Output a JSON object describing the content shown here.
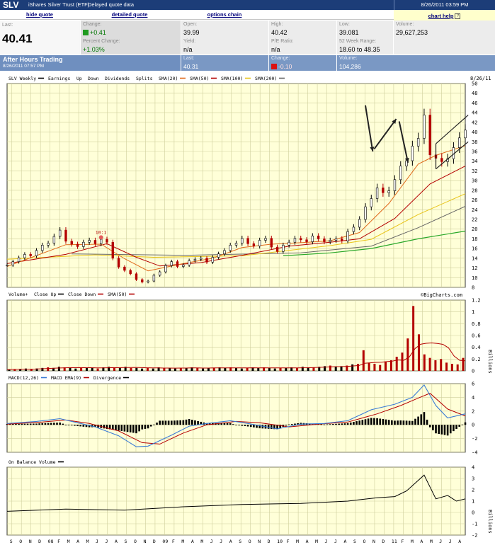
{
  "quote": {
    "symbol": "SLV",
    "name": "iShares Silver Trust (ETF)",
    "delay_note": "Delayed quote data",
    "timestamp": "8/26/2011 03:59 PM",
    "links": {
      "hide": "hide quote",
      "detailed": "detailed quote",
      "options": "options chain",
      "help": "chart help"
    },
    "last_label": "Last:",
    "last": "40.41",
    "change_label": "Change:",
    "change": "+0.41",
    "pct_label": "Percent Change:",
    "pct": "+1.03%",
    "open_label": "Open:",
    "open": "39.99",
    "yield_label": "Yield:",
    "yield": "n/a",
    "high_label": "High:",
    "high": "40.42",
    "pe_label": "P/E Ratio:",
    "pe": "n/a",
    "low_label": "Low:",
    "low": "39.081",
    "range_label": "52 Week Range:",
    "range": "18.60 to 48.35",
    "volume_label": "Volume:",
    "volume": "29,627,253"
  },
  "after_hours": {
    "title": "After Hours Trading",
    "time": "8/26/2011 07:57 PM",
    "last_label": "Last:",
    "last": "40.31",
    "change_label": "Change:",
    "change": "-0.10",
    "volume_label": "Volume:",
    "volume": "104,286"
  },
  "colors": {
    "header": "#1c3d78",
    "quote_bg": "#f0f0f0",
    "after_bg": "#7a98c4",
    "chart_bg": "#ffffd8",
    "grid": "#cfcf9d",
    "up": "#000000",
    "down": "#b40000",
    "sma20": "#e06a1a",
    "sma50": "#b40000",
    "sma100": "#e8c418",
    "sma200": "#666666",
    "green": "#2aa82a",
    "macd": "#3a7bd5",
    "signal": "#b40000"
  },
  "chart_data": {
    "type": "line",
    "panels": {
      "price": {
        "legend": [
          "SLV Weekly",
          "Earnings",
          "Up",
          "Down",
          "Dividends",
          "Splits",
          "SMA(20)",
          "SMA(50)",
          "SMA(100)",
          "SMA(200)"
        ],
        "date_label": "8/26/11",
        "yticks": [
          8,
          10,
          12,
          14,
          16,
          18,
          20,
          22,
          24,
          26,
          28,
          30,
          32,
          34,
          36,
          38,
          40,
          42,
          44,
          46,
          48,
          50
        ],
        "ylim": [
          8,
          50
        ],
        "split_label": "10:1",
        "watermark": "©BigCharts.com",
        "close": [
          [
            0,
            12.6
          ],
          [
            2,
            13.3
          ],
          [
            4,
            14.1
          ],
          [
            6,
            14.8
          ],
          [
            8,
            14.5
          ],
          [
            10,
            15.6
          ],
          [
            12,
            16.7
          ],
          [
            14,
            17.1
          ],
          [
            16,
            18.5
          ],
          [
            18,
            19.8
          ],
          [
            20,
            17.5
          ],
          [
            22,
            16.9
          ],
          [
            24,
            16.4
          ],
          [
            26,
            17.3
          ],
          [
            28,
            17.7
          ],
          [
            30,
            17.0
          ],
          [
            32,
            17.9
          ],
          [
            34,
            17.3
          ],
          [
            36,
            14.0
          ],
          [
            38,
            12.2
          ],
          [
            40,
            11.5
          ],
          [
            42,
            10.8
          ],
          [
            44,
            9.6
          ],
          [
            46,
            9.1
          ],
          [
            48,
            9.3
          ],
          [
            50,
            10.5
          ],
          [
            52,
            11.2
          ],
          [
            54,
            12.5
          ],
          [
            56,
            13.3
          ],
          [
            58,
            12.3
          ],
          [
            60,
            12.6
          ],
          [
            62,
            13.5
          ],
          [
            64,
            13.8
          ],
          [
            66,
            14.0
          ],
          [
            68,
            13.2
          ],
          [
            70,
            14.2
          ],
          [
            72,
            14.9
          ],
          [
            74,
            15.6
          ],
          [
            76,
            16.7
          ],
          [
            78,
            17.1
          ],
          [
            80,
            18.1
          ],
          [
            82,
            17.0
          ],
          [
            84,
            16.5
          ],
          [
            86,
            17.7
          ],
          [
            88,
            18.1
          ],
          [
            90,
            16.3
          ],
          [
            92,
            15.4
          ],
          [
            94,
            16.7
          ],
          [
            96,
            17.3
          ],
          [
            98,
            18.1
          ],
          [
            100,
            17.8
          ],
          [
            102,
            17.4
          ],
          [
            104,
            18.6
          ],
          [
            106,
            18.0
          ],
          [
            108,
            17.4
          ],
          [
            110,
            17.7
          ],
          [
            112,
            18.0
          ],
          [
            114,
            17.6
          ],
          [
            116,
            19.5
          ],
          [
            118,
            20.4
          ],
          [
            120,
            22.0
          ],
          [
            122,
            24.6
          ],
          [
            124,
            26.3
          ],
          [
            126,
            28.5
          ],
          [
            128,
            27.5
          ],
          [
            130,
            27.9
          ],
          [
            132,
            30.2
          ],
          [
            134,
            33.0
          ],
          [
            136,
            34.1
          ],
          [
            138,
            37.1
          ],
          [
            140,
            38.7
          ],
          [
            142,
            43.5
          ],
          [
            144,
            35.3
          ],
          [
            146,
            34.6
          ],
          [
            148,
            33.9
          ],
          [
            150,
            34.5
          ],
          [
            152,
            36.8
          ],
          [
            154,
            38.8
          ],
          [
            156,
            40.4
          ]
        ],
        "sma20": [
          [
            0,
            12.3
          ],
          [
            20,
            16.8
          ],
          [
            32,
            16.9
          ],
          [
            40,
            13.9
          ],
          [
            48,
            11.4
          ],
          [
            60,
            12.9
          ],
          [
            70,
            14.0
          ],
          [
            80,
            16.2
          ],
          [
            90,
            16.9
          ],
          [
            100,
            17.2
          ],
          [
            110,
            17.6
          ],
          [
            120,
            19.3
          ],
          [
            130,
            25.3
          ],
          [
            140,
            33.4
          ],
          [
            146,
            35.2
          ],
          [
            156,
            37.2
          ]
        ],
        "sma50": [
          [
            0,
            12.9
          ],
          [
            20,
            14.8
          ],
          [
            34,
            17.0
          ],
          [
            44,
            14.2
          ],
          [
            52,
            12.4
          ],
          [
            66,
            13.1
          ],
          [
            80,
            14.6
          ],
          [
            96,
            16.5
          ],
          [
            110,
            17.3
          ],
          [
            120,
            18.0
          ],
          [
            132,
            22.2
          ],
          [
            144,
            29.3
          ],
          [
            156,
            33.0
          ]
        ],
        "sma100": [
          [
            0,
            13.8
          ],
          [
            30,
            14.7
          ],
          [
            50,
            14.2
          ],
          [
            80,
            14.5
          ],
          [
            110,
            16.6
          ],
          [
            124,
            17.9
          ],
          [
            140,
            23.0
          ],
          [
            156,
            27.3
          ]
        ],
        "sma200": [
          [
            22,
            14.9
          ],
          [
            60,
            14.6
          ],
          [
            100,
            15.1
          ],
          [
            124,
            16.5
          ],
          [
            140,
            20.3
          ],
          [
            156,
            24.7
          ]
        ],
        "green": [
          [
            94,
            14.5
          ],
          [
            110,
            15.1
          ],
          [
            124,
            16.0
          ],
          [
            140,
            18.0
          ],
          [
            156,
            19.6
          ]
        ]
      },
      "volume": {
        "legend": [
          "Volume+",
          "Close Up",
          "Close Down",
          "SMA(50)"
        ],
        "unit": "Billions",
        "yticks": [
          0,
          0.2,
          0.4,
          0.6,
          0.8,
          1,
          1.2
        ],
        "ylim": [
          0,
          1.2
        ],
        "values": [
          0.02,
          0.03,
          0.03,
          0.04,
          0.03,
          0.04,
          0.05,
          0.06,
          0.05,
          0.07,
          0.06,
          0.05,
          0.04,
          0.06,
          0.05,
          0.05,
          0.04,
          0.06,
          0.07,
          0.06,
          0.05,
          0.07,
          0.05,
          0.05,
          0.04,
          0.05,
          0.04,
          0.06,
          0.05,
          0.05,
          0.04,
          0.05,
          0.05,
          0.06,
          0.05,
          0.04,
          0.05,
          0.05,
          0.06,
          0.05,
          0.06,
          0.05,
          0.04,
          0.05,
          0.06,
          0.05,
          0.06,
          0.05,
          0.04,
          0.05,
          0.05,
          0.06,
          0.05,
          0.07,
          0.06,
          0.06,
          0.07,
          0.08,
          0.09,
          0.07,
          0.08,
          0.09,
          0.11,
          0.12,
          0.35,
          0.14,
          0.12,
          0.1,
          0.16,
          0.18,
          0.24,
          0.31,
          0.55,
          1.1,
          0.62,
          0.28,
          0.22,
          0.18,
          0.2,
          0.14,
          0.12,
          0.11,
          0.22
        ]
      },
      "macd": {
        "legend": [
          "MACD(12,26)",
          "MACD EMA(9)",
          "Divergence"
        ],
        "yticks": [
          -4,
          -2,
          0,
          2,
          4,
          6
        ],
        "ylim": [
          -4,
          6
        ],
        "macd": [
          [
            0,
            0.2
          ],
          [
            10,
            0.5
          ],
          [
            18,
            0.9
          ],
          [
            24,
            0.3
          ],
          [
            30,
            -0.3
          ],
          [
            38,
            -1.6
          ],
          [
            44,
            -3.2
          ],
          [
            48,
            -3.1
          ],
          [
            56,
            -1.5
          ],
          [
            62,
            -0.2
          ],
          [
            68,
            0.2
          ],
          [
            76,
            0.6
          ],
          [
            82,
            0.2
          ],
          [
            92,
            -0.6
          ],
          [
            100,
            0.1
          ],
          [
            108,
            0.2
          ],
          [
            116,
            0.6
          ],
          [
            124,
            2.2
          ],
          [
            132,
            3.0
          ],
          [
            138,
            4.0
          ],
          [
            142,
            5.8
          ],
          [
            146,
            2.8
          ],
          [
            150,
            1.0
          ],
          [
            156,
            1.6
          ]
        ],
        "signal": [
          [
            0,
            0.1
          ],
          [
            12,
            0.4
          ],
          [
            20,
            0.7
          ],
          [
            28,
            0.2
          ],
          [
            38,
            -0.9
          ],
          [
            46,
            -2.6
          ],
          [
            52,
            -2.8
          ],
          [
            60,
            -1.2
          ],
          [
            68,
            0.0
          ],
          [
            78,
            0.5
          ],
          [
            86,
            0.3
          ],
          [
            96,
            -0.3
          ],
          [
            106,
            0.1
          ],
          [
            116,
            0.4
          ],
          [
            126,
            1.6
          ],
          [
            134,
            2.8
          ],
          [
            140,
            3.9
          ],
          [
            144,
            4.6
          ],
          [
            150,
            2.3
          ],
          [
            156,
            1.3
          ]
        ]
      },
      "obv": {
        "legend": [
          "On Balance Volume"
        ],
        "unit": "Billions",
        "yticks": [
          -2,
          -1,
          0,
          1,
          2,
          3,
          4
        ],
        "ylim": [
          -2,
          4
        ],
        "values": [
          [
            0,
            0.1
          ],
          [
            20,
            0.3
          ],
          [
            40,
            0.2
          ],
          [
            60,
            0.5
          ],
          [
            80,
            0.7
          ],
          [
            100,
            0.8
          ],
          [
            116,
            1.0
          ],
          [
            126,
            1.3
          ],
          [
            132,
            1.4
          ],
          [
            136,
            1.9
          ],
          [
            142,
            3.3
          ],
          [
            146,
            1.2
          ],
          [
            150,
            1.5
          ],
          [
            153,
            1.0
          ],
          [
            156,
            1.2
          ]
        ]
      }
    },
    "x_month_labels": [
      "S",
      "O",
      "N",
      "D",
      "08",
      "F",
      "M",
      "A",
      "M",
      "J",
      "J",
      "A",
      "S",
      "O",
      "N",
      "D",
      "09",
      "F",
      "M",
      "A",
      "M",
      "J",
      "J",
      "A",
      "S",
      "O",
      "N",
      "D",
      "10",
      "F",
      "M",
      "A",
      "M",
      "J",
      "J",
      "A",
      "S",
      "O",
      "N",
      "D",
      "11",
      "F",
      "M",
      "A",
      "M",
      "J",
      "J",
      "A"
    ]
  }
}
